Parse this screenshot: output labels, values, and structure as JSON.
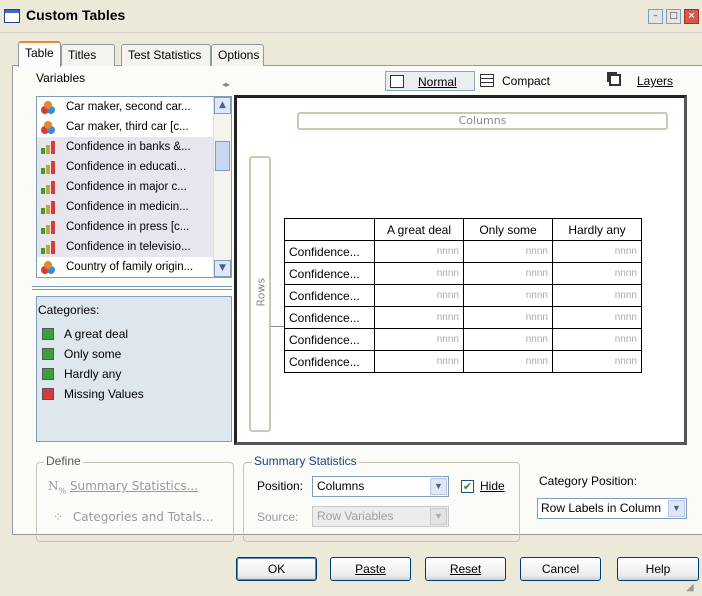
{
  "window": {
    "title": "Custom Tables"
  },
  "tabs": [
    {
      "label": "Table",
      "active": true
    },
    {
      "label": "Titles"
    },
    {
      "label": "Test Statistics"
    },
    {
      "label": "Options"
    }
  ],
  "variables": {
    "label": "Variables",
    "items": [
      {
        "label": "Car maker, second car...",
        "icon": "nominal-icon"
      },
      {
        "label": "Car maker, third car [c...",
        "icon": "nominal-icon"
      },
      {
        "label": "Confidence in banks &...",
        "icon": "ordinal-icon"
      },
      {
        "label": "Confidence in educati...",
        "icon": "ordinal-icon"
      },
      {
        "label": "Confidence in major c...",
        "icon": "ordinal-icon"
      },
      {
        "label": "Confidence in medicin...",
        "icon": "ordinal-icon"
      },
      {
        "label": "Confidence in press [c...",
        "icon": "ordinal-icon"
      },
      {
        "label": "Confidence in televisio...",
        "icon": "ordinal-icon"
      },
      {
        "label": "Country of family origin...",
        "icon": "nominal-icon"
      }
    ]
  },
  "categories": {
    "label": "Categories:",
    "items": [
      {
        "label": "A great deal",
        "color": "#3aa03a"
      },
      {
        "label": "Only some",
        "color": "#3aa03a"
      },
      {
        "label": "Hardly any",
        "color": "#3aa03a"
      },
      {
        "label": "Missing Values",
        "color": "#d83a3a"
      }
    ]
  },
  "view": {
    "normal": "Normal",
    "compact": "Compact",
    "layers": "Layers"
  },
  "canvas": {
    "columns_label": "Columns",
    "rows_label": "Rows",
    "table": {
      "headers": [
        "A great deal",
        "Only some",
        "Hardly any"
      ],
      "rows": [
        {
          "label": "Confidence...",
          "cells": [
            "nnnn",
            "nnnn",
            "nnnn"
          ]
        },
        {
          "label": "Confidence...",
          "cells": [
            "nnnn",
            "nnnn",
            "nnnn"
          ]
        },
        {
          "label": "Confidence...",
          "cells": [
            "nnnn",
            "nnnn",
            "nnnn"
          ]
        },
        {
          "label": "Confidence...",
          "cells": [
            "nnnn",
            "nnnn",
            "nnnn"
          ]
        },
        {
          "label": "Confidence...",
          "cells": [
            "nnnn",
            "nnnn",
            "nnnn"
          ]
        },
        {
          "label": "Confidence...",
          "cells": [
            "nnnn",
            "nnnn",
            "nnnn"
          ]
        }
      ]
    }
  },
  "define": {
    "label": "Define",
    "summary_statistics": "Summary Statistics...",
    "categories_and_totals": "Categories and Totals..."
  },
  "summary_statistics": {
    "label": "Summary Statistics",
    "position_label": "Position:",
    "position_value": "Columns",
    "hide_label": "Hide",
    "hide_checked": true,
    "source_label": "Source:",
    "source_value": "Row Variables"
  },
  "category_position": {
    "label": "Category Position:",
    "value": "Row Labels in Column"
  },
  "buttons": {
    "ok": "OK",
    "paste": "Paste",
    "reset": "Reset",
    "cancel": "Cancel",
    "help": "Help"
  }
}
